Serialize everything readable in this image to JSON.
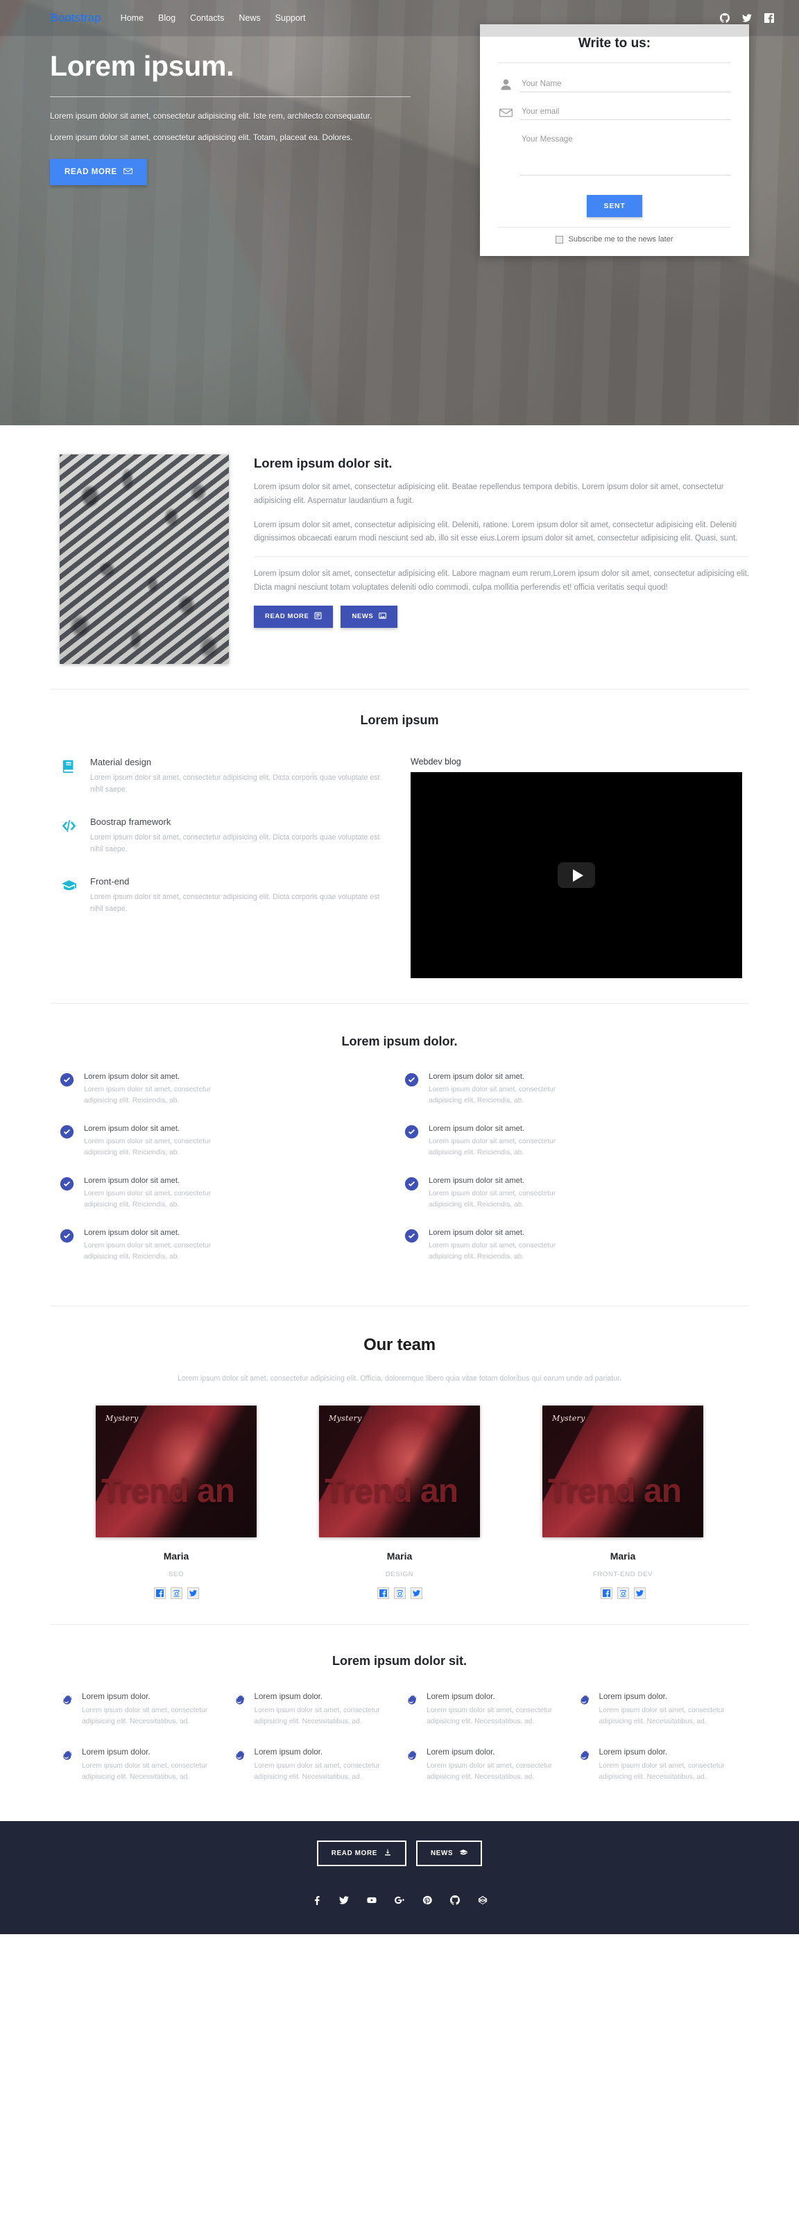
{
  "navbar": {
    "brand": "Bootstrap",
    "links": [
      "Home",
      "Blog",
      "Contacts",
      "News",
      "Support"
    ],
    "socials": [
      "github-icon",
      "twitter-icon",
      "facebook-icon"
    ]
  },
  "hero": {
    "title": "Lorem ipsum.",
    "paragraph1": "Lorem ipsum dolor sit amet, consectetur adipisicing elit. Iste rem, architecto consequatur.",
    "paragraph2": "Lorem ipsum dolor sit amet, consectetur adipisicing elit. Totam, placeat ea. Dolores.",
    "cta_label": "READ MORE",
    "cta_icon": "envelope-icon"
  },
  "contact_form": {
    "title": "Write to us:",
    "name_placeholder": "Your Name",
    "name_value": "",
    "name_icon": "person-icon",
    "email_placeholder": "Your email",
    "email_value": "",
    "email_icon": "envelope-icon",
    "message_placeholder": "Your Message",
    "message_value": "",
    "submit_label": "SENT",
    "subscribe_label": "Subscribe me to the news later",
    "subscribe_checked": false
  },
  "article": {
    "heading": "Lorem ipsum dolor sit.",
    "paragraph1": "Lorem ipsum dolor sit amet, consectetur adipisicing elit. Beatae repellendus tempora debitis. Lorem ipsum dolor sit amet, consectetur adipisicing elit. Aspernatur laudantium a fugit.",
    "paragraph2": "Lorem ipsum dolor sit amet, consectetur adipisicing elit. Deleniti, ratione. Lorem ipsum dolor sit amet, consectetur adipisicing elit. Deleniti dignissimos obcaecati earum modi nesciunt sed ab, illo sit esse eius.Lorem ipsum dolor sit amet, consectetur adipisicing elit. Quasi, sunt.",
    "paragraph3": "Lorem ipsum dolor sit amet, consectetur adipisicing elit. Labore magnam eum rerum,Lorem ipsum dolor sit amet, consectetur adipisicing elit. Dicta magni nesciunt totam voluptates deleniti odio commodi, culpa mollitia perferendis et! officia veritatis sequi quod!",
    "btn_read_more": "READ MORE",
    "btn_read_more_icon": "article-icon",
    "btn_news": "NEWS",
    "btn_news_icon": "image-icon",
    "image_alt": "crowd-crosswalk-photo"
  },
  "features": {
    "heading": "Lorem ipsum",
    "items": [
      {
        "icon": "book-icon",
        "title": "Material design",
        "text": "Lorem ipsum dolor sit amet, consectetur adipisicing elit. Dicta corporis quae voluptate est nihil saepe."
      },
      {
        "icon": "code-icon",
        "title": "Boostrap framework",
        "text": "Lorem ipsum dolor sit amet, consectetur adipisicing elit. Dicta corporis quae voluptate est nihil saepe."
      },
      {
        "icon": "graduation-cap-icon",
        "title": "Front-end",
        "text": "Lorem ipsum dolor sit amet, consectetur adipisicing elit. Dicta corporis quae voluptate est nihil saepe."
      }
    ],
    "video_label": "Webdev blog",
    "video_play_icon": "play-icon"
  },
  "checklist": {
    "heading": "Lorem ipsum dolor.",
    "icon": "check-circle-icon",
    "left": [
      {
        "title": "Lorem ipsum dolor sit amet.",
        "text": "Lorem ipsum dolor sit amet, consectetur adipisicing elit. Reiciendis, ab."
      },
      {
        "title": "Lorem ipsum dolor sit amet.",
        "text": "Lorem ipsum dolor sit amet, consectetur adipisicing elit. Reiciendis, ab."
      },
      {
        "title": "Lorem ipsum dolor sit amet.",
        "text": "Lorem ipsum dolor sit amet, consectetur adipisicing elit. Reiciendis, ab."
      },
      {
        "title": "Lorem ipsum dolor sit amet.",
        "text": "Lorem ipsum dolor sit amet, consectetur adipisicing elit. Reiciendis, ab."
      }
    ],
    "right": [
      {
        "title": "Lorem ipsum dolor sit amet.",
        "text": "Lorem ipsum dolor sit amet, consectetur adipisicing elit. Reiciendis, ab."
      },
      {
        "title": "Lorem ipsum dolor sit amet.",
        "text": "Lorem ipsum dolor sit amet, consectetur adipisicing elit. Reiciendis, ab."
      },
      {
        "title": "Lorem ipsum dolor sit amet.",
        "text": "Lorem ipsum dolor sit amet, consectetur adipisicing elit. Reiciendis, ab."
      },
      {
        "title": "Lorem ipsum dolor sit amet.",
        "text": "Lorem ipsum dolor sit amet, consectetur adipisicing elit. Reiciendis, ab."
      }
    ]
  },
  "team": {
    "heading": "Our team",
    "subheading": "Lorem ipsum dolor sit amet, consectetur adipisicing elit. Officia, doloremque libero quia vitae totam doloribus qui earum unde ad pariatur.",
    "poster_brand": "Mystery",
    "poster_text": "Trend an",
    "members": [
      {
        "name": "Maria",
        "role": "SEO",
        "socials": [
          "facebook-icon",
          "instagram-icon",
          "twitter-icon"
        ]
      },
      {
        "name": "Maria",
        "role": "DESIGN",
        "socials": [
          "facebook-icon",
          "instagram-icon",
          "twitter-icon"
        ]
      },
      {
        "name": "Maria",
        "role": "FRONT-END DEV",
        "socials": [
          "facebook-icon",
          "instagram-icon",
          "twitter-icon"
        ]
      }
    ]
  },
  "bottom_features": {
    "heading": "Lorem ipsum dolor sit.",
    "icon": "firefox-icon",
    "items": [
      {
        "title": "Lorem ipsum dolor.",
        "text": "Lorem ipsum dolor sit amet, consectetur adipisicing elit. Necessitatibus, ad."
      },
      {
        "title": "Lorem ipsum dolor.",
        "text": "Lorem ipsum dolor sit amet, consectetur adipisicing elit. Necessitatibus, ad."
      },
      {
        "title": "Lorem ipsum dolor.",
        "text": "Lorem ipsum dolor sit amet, consectetur adipisicing elit. Necessitatibus, ad."
      },
      {
        "title": "Lorem ipsum dolor.",
        "text": "Lorem ipsum dolor sit amet, consectetur adipisicing elit. Necessitatibus, ad."
      },
      {
        "title": "Lorem ipsum dolor.",
        "text": "Lorem ipsum dolor sit amet, consectetur adipisicing elit. Necessitatibus, ad."
      },
      {
        "title": "Lorem ipsum dolor.",
        "text": "Lorem ipsum dolor sit amet, consectetur adipisicing elit. Necessitatibus, ad."
      },
      {
        "title": "Lorem ipsum dolor.",
        "text": "Lorem ipsum dolor sit amet, consectetur adipisicing elit. Necessitatibus, ad."
      },
      {
        "title": "Lorem ipsum dolor.",
        "text": "Lorem ipsum dolor sit amet, consectetur adipisicing elit. Necessitatibus, ad."
      }
    ]
  },
  "footer": {
    "btn_read_more": "READ MORE",
    "btn_read_more_icon": "download-icon",
    "btn_news": "NEWS",
    "btn_news_icon": "graduation-cap-icon",
    "socials": [
      "facebook-icon",
      "twitter-icon",
      "youtube-icon",
      "google-plus-icon",
      "pinterest-icon",
      "github-icon",
      "codepen-icon"
    ]
  },
  "colors": {
    "brand_blue": "#1a73ff",
    "primary_blue": "#4285f4",
    "indigo": "#3f51b5",
    "cyan": "#21b6d6",
    "footer_bg": "#212738",
    "muted_text": "#bdc1c6"
  }
}
